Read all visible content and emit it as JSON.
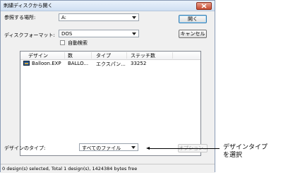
{
  "dialog": {
    "title": "刺繍ディスクから開く",
    "look_in": {
      "label": "参照する場所:",
      "value": "A:"
    },
    "disk_format": {
      "label": "ディスクフォーマット:",
      "value": "DOS"
    },
    "auto_detect": {
      "label": "自動検索",
      "checked": false
    },
    "buttons": {
      "open": "開く",
      "cancel": "キャンセル",
      "options": "オプション..."
    },
    "list": {
      "columns": [
        "デザイン",
        "数",
        "タイプ",
        "ステッチ数"
      ],
      "rows": [
        {
          "icon": "embroidery-file-icon",
          "design": "Balloon.EXP",
          "count": "BALLO...",
          "type": "エクスパン...",
          "stitches": "33252"
        }
      ]
    },
    "design_type": {
      "label": "デザインのタイプ:",
      "value": "すべてのファイル"
    },
    "status": "0 design(s) selected, Total 1 design(s), 1424384 bytes free"
  },
  "callout": {
    "line1": "デザインタイプ",
    "line2": "を選択"
  }
}
